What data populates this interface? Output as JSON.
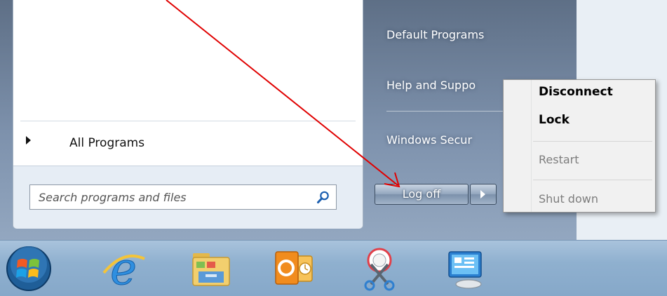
{
  "left_pane": {
    "all_programs_label": "All Programs",
    "search_placeholder": "Search programs and files"
  },
  "right_pane": {
    "items": [
      {
        "label": "Default Programs"
      },
      {
        "label": "Help and Suppo"
      },
      {
        "label": "Windows Secur"
      }
    ],
    "logoff_label": "Log off"
  },
  "context_menu": {
    "items": [
      {
        "label": "Disconnect",
        "enabled": true
      },
      {
        "label": "Lock",
        "enabled": true
      },
      {
        "label": "Restart",
        "enabled": false
      },
      {
        "label": "Shut down",
        "enabled": false
      }
    ]
  },
  "taskbar": {
    "icons": [
      "windows-start-orb-icon",
      "internet-explorer-icon",
      "file-explorer-icon",
      "outlook-icon",
      "snipping-tool-icon",
      "remote-desktop-icon"
    ]
  },
  "colors": {
    "annotation_arrow": "#e00000",
    "taskbar": "#8fb0cf",
    "frame": "#7d91ac"
  }
}
